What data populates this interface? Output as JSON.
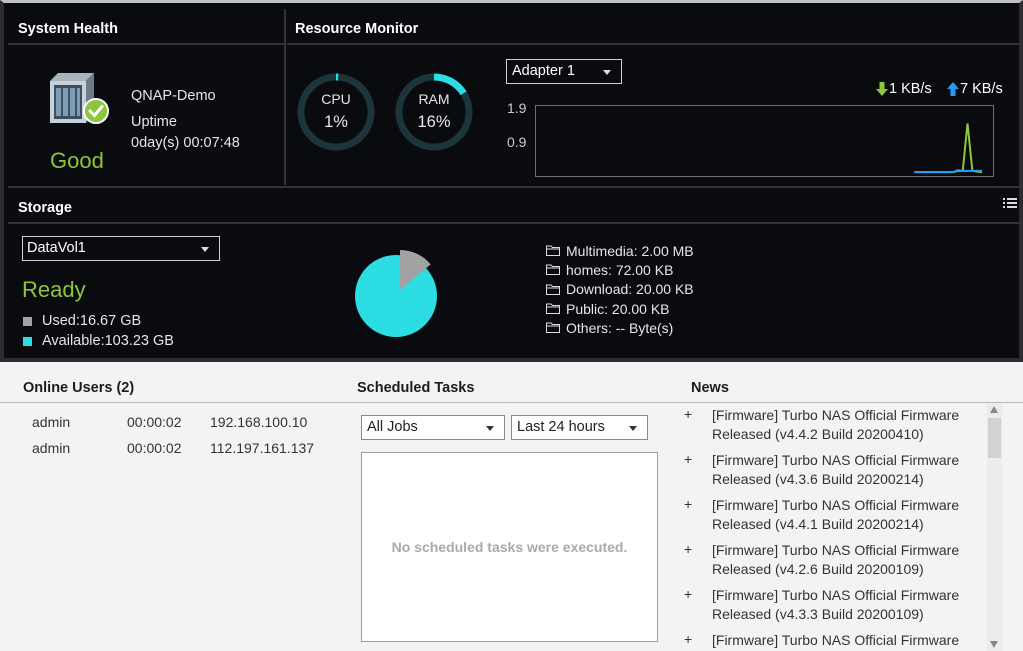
{
  "system_health": {
    "title": "System Health",
    "device_name": "QNAP-Demo",
    "uptime_label": "Uptime",
    "uptime_value": "0day(s) 00:07:48",
    "status": "Good"
  },
  "resource_monitor": {
    "title": "Resource Monitor",
    "cpu": {
      "label": "CPU",
      "value": "1%",
      "percent": 1
    },
    "ram": {
      "label": "RAM",
      "value": "16%",
      "percent": 16
    },
    "adapter": "Adapter 1",
    "download_rate": "1 KB/s",
    "upload_rate": "7 KB/s",
    "y_ticks": [
      "1.9",
      "0.9"
    ],
    "chart_data": {
      "type": "line",
      "series": [
        {
          "color": "#8cc63e",
          "values": [
            0.0,
            0.0,
            0.0,
            0.0,
            0.0,
            0.0,
            0.0,
            0.0,
            0.0,
            0.05,
            0.05,
            1.9,
            0.05,
            0.02,
            0.0
          ]
        },
        {
          "color": "#2b9bf0",
          "values": [
            0.0,
            0.0,
            0.0,
            0.0,
            0.0,
            0.0,
            0.0,
            0.0,
            0.0,
            0.08,
            0.05,
            0.05,
            0.05,
            0.05,
            0.05
          ]
        }
      ],
      "ylim": [
        0,
        1.9
      ]
    }
  },
  "storage": {
    "title": "Storage",
    "volume": "DataVol1",
    "status": "Ready",
    "used_label": "Used:16.67 GB",
    "available_label": "Available:103.23 GB",
    "used_gb": 16.67,
    "available_gb": 103.23,
    "colors": {
      "used": "#a2a2a2",
      "available": "#2ddde4"
    },
    "folders": [
      {
        "name": "Multimedia",
        "size": "2.00 MB"
      },
      {
        "name": "homes",
        "size": "72.00 KB"
      },
      {
        "name": "Download",
        "size": "20.00 KB"
      },
      {
        "name": "Public",
        "size": "20.00 KB"
      },
      {
        "name": "Others",
        "size": "-- Byte(s)"
      }
    ]
  },
  "online_users": {
    "title": "Online Users (2)",
    "rows": [
      {
        "user": "admin",
        "time": "00:00:02",
        "ip": "192.168.100.10"
      },
      {
        "user": "admin",
        "time": "00:00:02",
        "ip": "112.197.161.137"
      }
    ]
  },
  "scheduled_tasks": {
    "title": "Scheduled Tasks",
    "job_filter": "All Jobs",
    "time_filter": "Last 24 hours",
    "empty_text": "No scheduled tasks were executed."
  },
  "news": {
    "title": "News",
    "items": [
      {
        "text": "[Firmware] Turbo NAS Official Firmware Released (v4.4.2 Build 20200410)"
      },
      {
        "text": "[Firmware] Turbo NAS Official Firmware Released (v4.3.6 Build 20200214)"
      },
      {
        "text": "[Firmware] Turbo NAS Official Firmware Released (v4.4.1 Build 20200214)"
      },
      {
        "text": "[Firmware] Turbo NAS Official Firmware Released (v4.2.6 Build 20200109)"
      },
      {
        "text": "[Firmware] Turbo NAS Official Firmware Released (v4.3.3 Build 20200109)"
      },
      {
        "text": "[Firmware] Turbo NAS Official Firmware"
      }
    ]
  },
  "accent_color": "#2ddde4",
  "ok_color": "#8cc63e"
}
